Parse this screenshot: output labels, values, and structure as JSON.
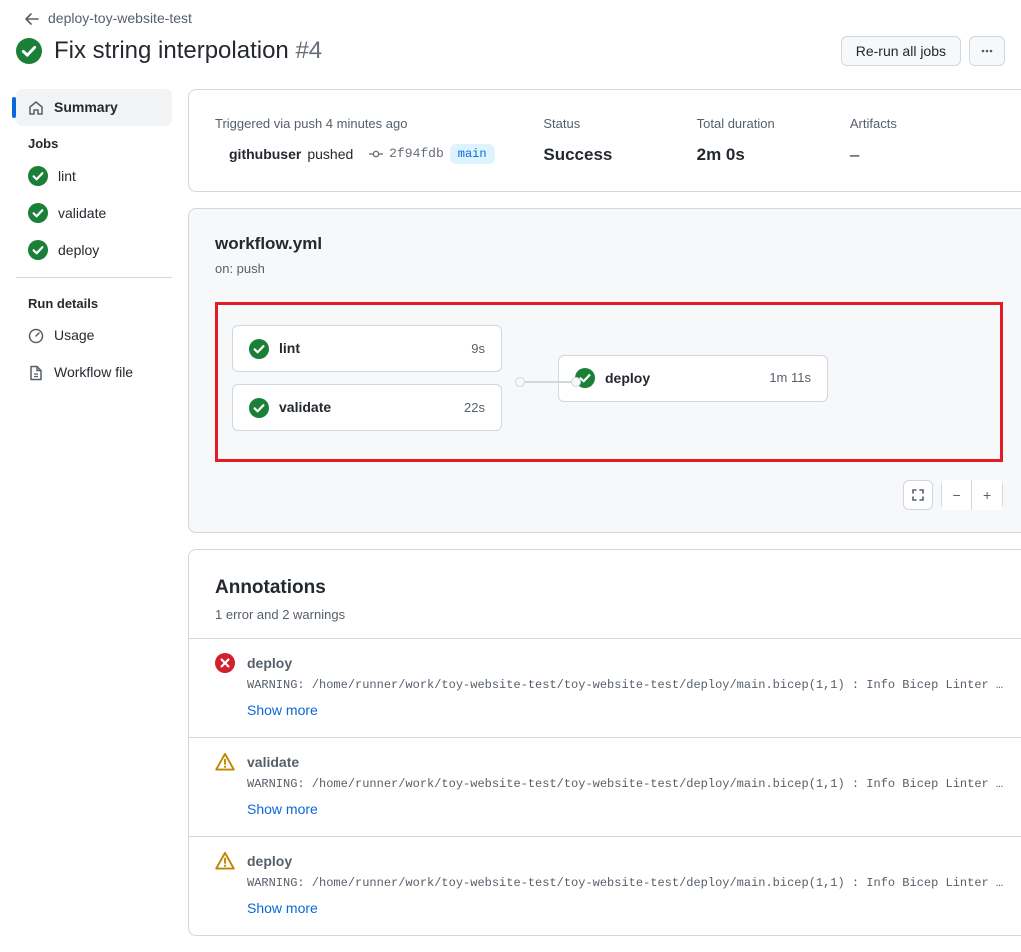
{
  "back_link": "deploy-toy-website-test",
  "title": "Fix string interpolation",
  "run_number": "#4",
  "rerun_label": "Re-run all jobs",
  "summary_nav_label": "Summary",
  "jobs_heading": "Jobs",
  "jobs": [
    {
      "name": "lint"
    },
    {
      "name": "validate"
    },
    {
      "name": "deploy"
    }
  ],
  "run_details_heading": "Run details",
  "usage_label": "Usage",
  "workflow_file_label": "Workflow file",
  "summary": {
    "trigger_text": "Triggered via push 4 minutes ago",
    "actor": "githubuser",
    "action": "pushed",
    "commit_sha": "2f94fdb",
    "branch": "main",
    "status_label": "Status",
    "status_value": "Success",
    "duration_label": "Total duration",
    "duration_value": "2m 0s",
    "artifacts_label": "Artifacts",
    "artifacts_value": "–"
  },
  "workflow": {
    "file": "workflow.yml",
    "trigger": "on: push",
    "group1": [
      {
        "name": "lint",
        "time": "9s"
      },
      {
        "name": "validate",
        "time": "22s"
      }
    ],
    "group2": [
      {
        "name": "deploy",
        "time": "1m 11s"
      }
    ]
  },
  "annotations": {
    "title": "Annotations",
    "summary": "1 error and 2 warnings",
    "items": [
      {
        "level": "error",
        "job": "deploy",
        "message": "WARNING: /home/runner/work/toy-website-test/toy-website-test/deploy/main.bicep(1,1) : Info Bicep Linter …",
        "show_more": "Show more"
      },
      {
        "level": "warning",
        "job": "validate",
        "message": "WARNING: /home/runner/work/toy-website-test/toy-website-test/deploy/main.bicep(1,1) : Info Bicep Linter …",
        "show_more": "Show more"
      },
      {
        "level": "warning",
        "job": "deploy",
        "message": "WARNING: /home/runner/work/toy-website-test/toy-website-test/deploy/main.bicep(1,1) : Info Bicep Linter …",
        "show_more": "Show more"
      }
    ]
  }
}
